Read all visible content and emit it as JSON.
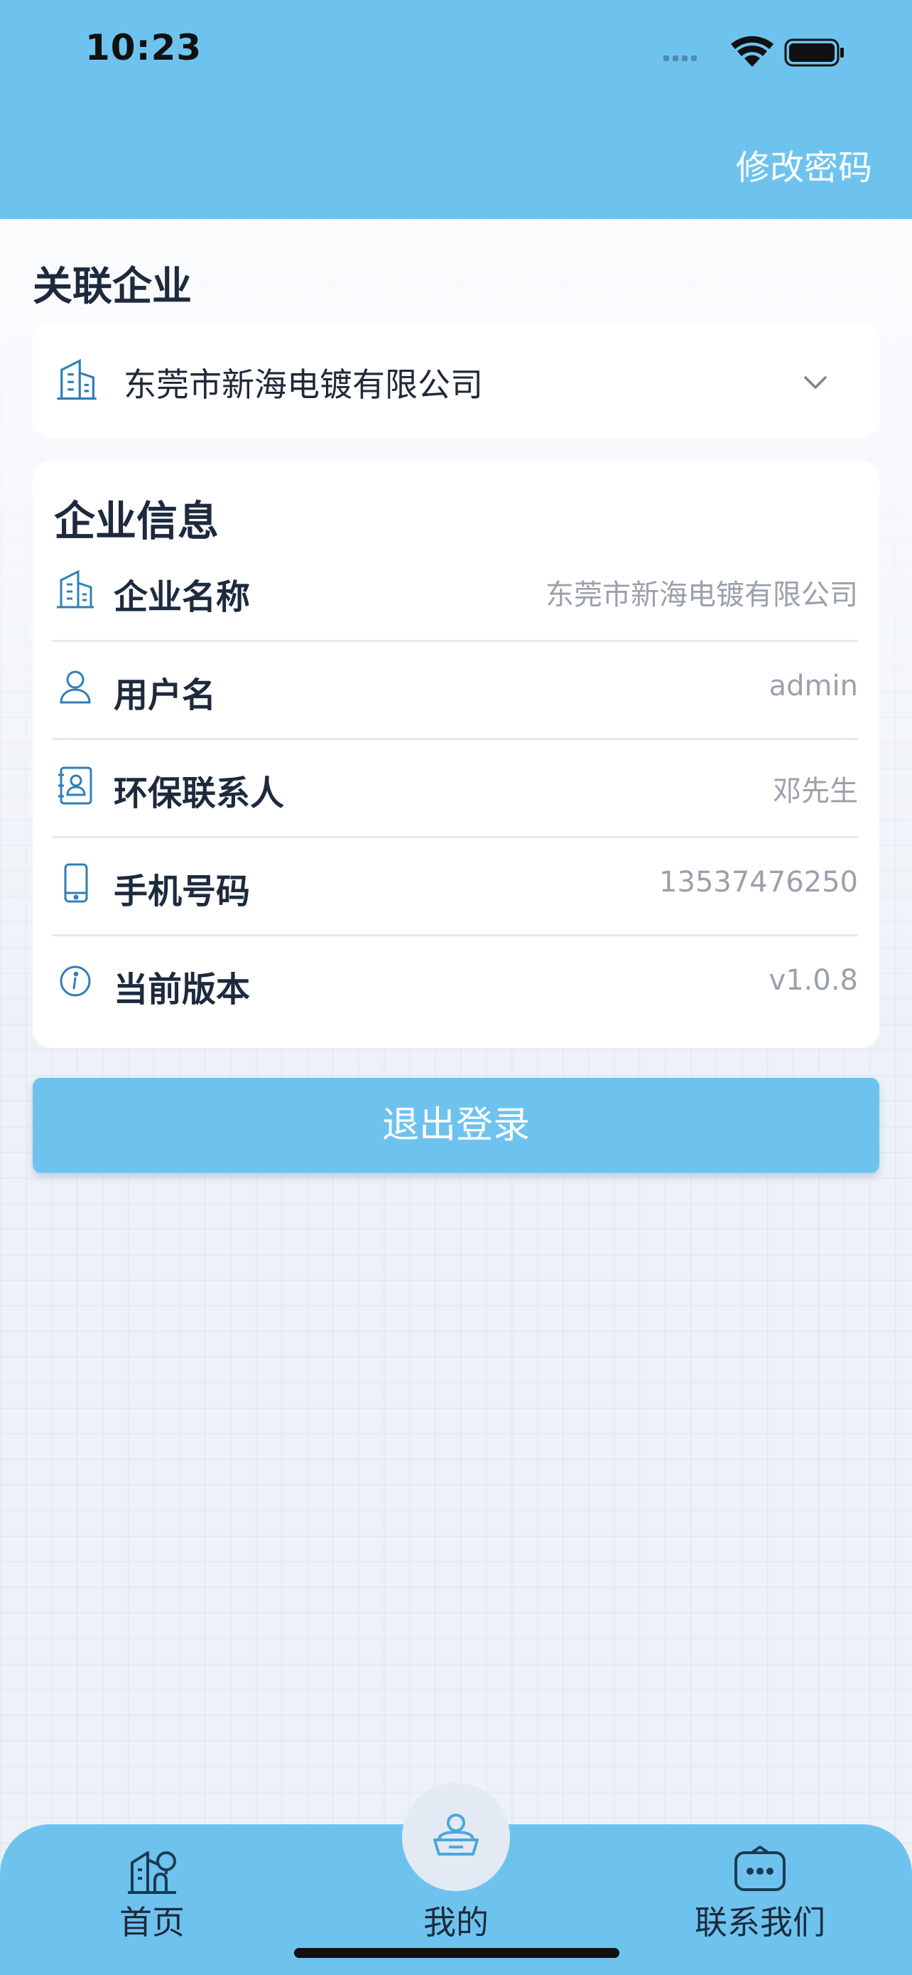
{
  "status_bar": {
    "time": "10:23"
  },
  "header": {
    "action_label": "修改密码"
  },
  "linked_company": {
    "title": "关联企业",
    "selected": "东莞市新海电镀有限公司"
  },
  "info_card": {
    "title": "企业信息",
    "rows": [
      {
        "icon": "building-icon",
        "label": "企业名称",
        "value": "东莞市新海电镀有限公司"
      },
      {
        "icon": "user-icon",
        "label": "用户名",
        "value": "admin"
      },
      {
        "icon": "contact-card-icon",
        "label": "环保联系人",
        "value": "邓先生"
      },
      {
        "icon": "phone-icon",
        "label": "手机号码",
        "value": "13537476250"
      },
      {
        "icon": "info-icon",
        "label": "当前版本",
        "value": "v1.0.8"
      }
    ]
  },
  "logout_label": "退出登录",
  "tabbar": {
    "tabs": [
      {
        "label": "首页",
        "icon": "home-building-icon"
      },
      {
        "label": "我的",
        "icon": "profile-icon",
        "active": true
      },
      {
        "label": "联系我们",
        "icon": "chat-bubble-icon"
      }
    ]
  },
  "colors": {
    "primary": "#6ec3ee",
    "text_dark": "#1d2a3e",
    "text_muted": "#9aa1ab",
    "icon_blue": "#2f7fb7"
  }
}
